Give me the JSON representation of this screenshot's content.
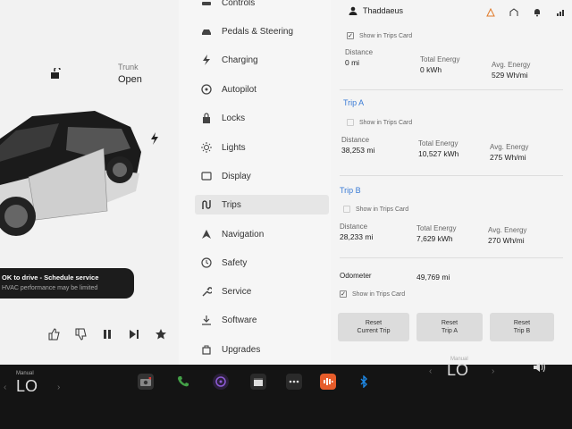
{
  "car": {
    "trunk_label": "Trunk",
    "trunk_value": "Open",
    "alert_title": "OK to drive - Schedule service",
    "alert_sub": "HVAC performance may be limited"
  },
  "menu": {
    "items": [
      {
        "label": "Controls",
        "icon": "car-icon"
      },
      {
        "label": "Pedals & Steering",
        "icon": "car-icon"
      },
      {
        "label": "Charging",
        "icon": "bolt-icon"
      },
      {
        "label": "Autopilot",
        "icon": "steering-wheel-icon"
      },
      {
        "label": "Locks",
        "icon": "lock-icon"
      },
      {
        "label": "Lights",
        "icon": "sun-icon"
      },
      {
        "label": "Display",
        "icon": "display-icon"
      },
      {
        "label": "Trips",
        "icon": "trips-icon"
      },
      {
        "label": "Navigation",
        "icon": "navigation-icon"
      },
      {
        "label": "Safety",
        "icon": "safety-icon"
      },
      {
        "label": "Service",
        "icon": "wrench-icon"
      },
      {
        "label": "Software",
        "icon": "download-icon"
      },
      {
        "label": "Upgrades",
        "icon": "bag-icon"
      }
    ],
    "active": "Trips"
  },
  "header": {
    "user": "Thaddaeus"
  },
  "trips": {
    "show_label": "Show in Trips Card",
    "current": {
      "distance_label": "Distance",
      "distance": "0 mi",
      "energy_label": "Total Energy",
      "energy": "0 kWh",
      "avg_label": "Avg. Energy",
      "avg": "529 Wh/mi"
    },
    "a": {
      "title": "Trip A",
      "distance_label": "Distance",
      "distance": "38,253 mi",
      "energy_label": "Total Energy",
      "energy": "10,527 kWh",
      "avg_label": "Avg. Energy",
      "avg": "275 Wh/mi"
    },
    "b": {
      "title": "Trip B",
      "distance_label": "Distance",
      "distance": "28,233 mi",
      "energy_label": "Total Energy",
      "energy": "7,629 kWh",
      "avg_label": "Avg. Energy",
      "avg": "270 Wh/mi"
    },
    "odometer_label": "Odometer",
    "odometer": "49,769 mi",
    "reset_current": [
      "Reset",
      "Current Trip"
    ],
    "reset_a": [
      "Reset",
      "Trip A"
    ],
    "reset_b": [
      "Reset",
      "Trip B"
    ]
  },
  "taskbar": {
    "left_mode": "Manual",
    "left_temp": "LO",
    "right_mode": "Manual",
    "right_temp": "LO",
    "accent_red": "#e53935",
    "accent_green": "#43a047",
    "accent_blue": "#1e88e5"
  }
}
